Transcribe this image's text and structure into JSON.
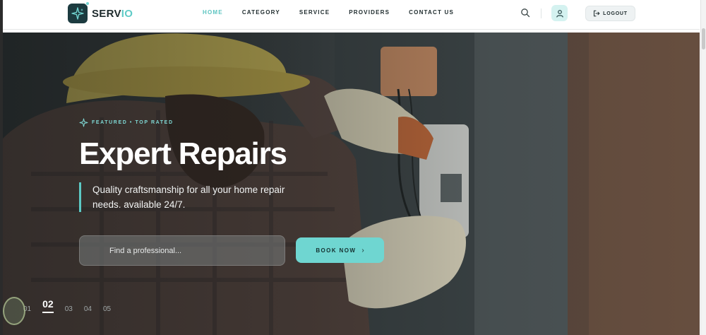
{
  "header": {
    "logo_prefix": "SERV",
    "logo_suffix": "IO",
    "nav": [
      {
        "label": "HOME",
        "active": true
      },
      {
        "label": "CATEGORY",
        "active": false
      },
      {
        "label": "SERVICE",
        "active": false
      },
      {
        "label": "PROVIDERS",
        "active": false
      },
      {
        "label": "CONTACT US",
        "active": false
      }
    ],
    "icons": {
      "search": "search-icon",
      "user": "user-icon",
      "logout": "logout-icon"
    },
    "logout_label": "LOGOUT"
  },
  "hero": {
    "eyebrow": "FEATURED • TOP RATED",
    "title": "Expert Repairs",
    "description": "Quality craftsmanship for all your home repair needs. available 24/7.",
    "search_placeholder": "Find a professional...",
    "book_label": "BOOK NOW",
    "slides": [
      "01",
      "02",
      "03",
      "04",
      "05"
    ],
    "active_slide": "02"
  },
  "colors": {
    "accent": "#5cc9c5",
    "brand_dark": "#1c3b40",
    "button": "#6fd6d1"
  }
}
